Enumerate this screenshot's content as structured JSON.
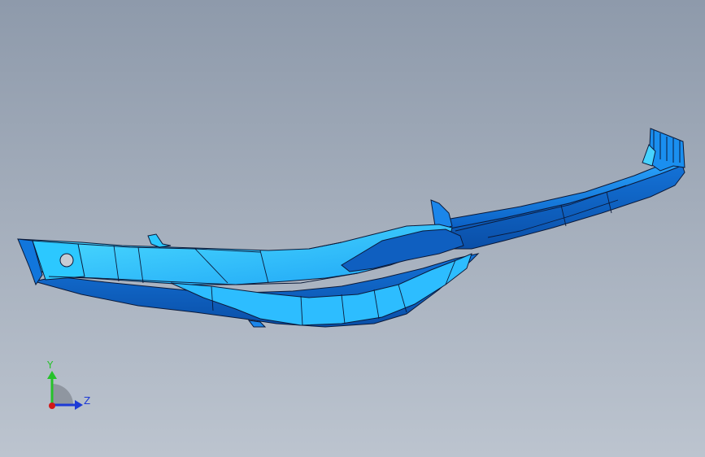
{
  "viewport": {
    "background_top": "#8e9aab",
    "background_bottom": "#bcc4cf"
  },
  "model": {
    "part_color": "#1a8ff0",
    "highlight_color": "#2cc8ff",
    "shadow_color": "#0a5ec4",
    "edge_color": "#0b1a3a"
  },
  "triad": {
    "y_label": "Y",
    "z_label": "Z",
    "y_color": "#26c22a",
    "z_color": "#1d3ad6",
    "x_color": "#d11818",
    "plane_color": "#8f96a0"
  }
}
